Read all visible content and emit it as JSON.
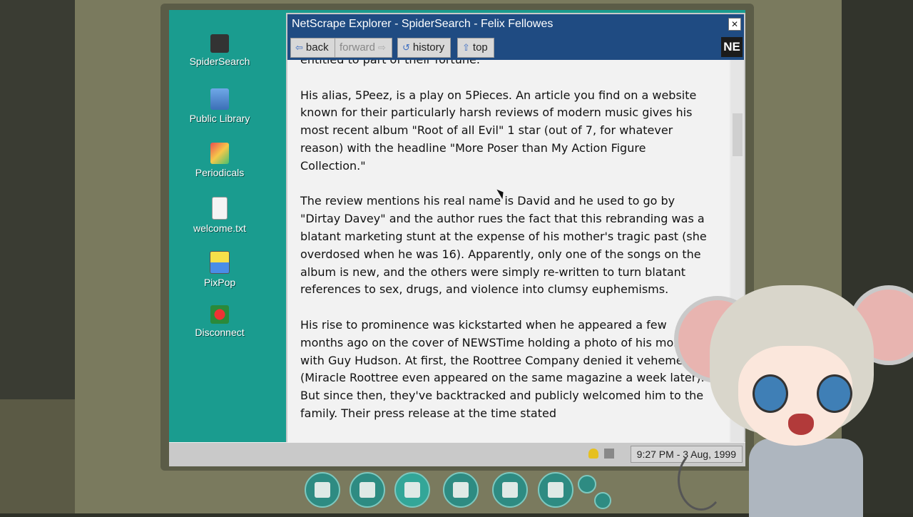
{
  "desktop": {
    "icons": [
      {
        "label": "SpiderSearch",
        "icon": "spider-icon"
      },
      {
        "label": "Public Library",
        "icon": "book-icon"
      },
      {
        "label": "Periodicals",
        "icon": "magazine-icon"
      },
      {
        "label": "welcome.txt",
        "icon": "text-file-icon"
      },
      {
        "label": "PixPop",
        "icon": "image-icon"
      },
      {
        "label": "Disconnect",
        "icon": "disconnect-icon"
      }
    ]
  },
  "window": {
    "title": "NetScrape Explorer - SpiderSearch - Felix Fellowes",
    "close_label": "✕",
    "toolbar": {
      "back_label": "back",
      "back_arrow": "⇦",
      "forward_label": "forward",
      "forward_arrow": "⇨",
      "history_label": "history",
      "history_icon": "↺",
      "top_label": "top",
      "top_arrow": "⇧",
      "logo_text": "NE"
    },
    "article": {
      "paragraphs": [
        "entitled to part of their fortune.",
        "His alias, 5Peez, is a play on 5Pieces. An article you find on a website known for their particularly harsh reviews of modern music gives his most recent album \"Root of all Evil\" 1 star (out of 7, for whatever reason) with the headline \"More Poser than My Action Figure Collection.\"",
        "The review mentions his real name is David and he used to go by \"Dirtay Davey\" and the author rues the fact that this rebranding was a blatant marketing stunt at the expense of his mother's tragic past (she overdosed when he was 16). Apparently, only one of the songs on the album is new, and the others were simply re-written to turn blatant references to sex, drugs, and violence into clumsy euphemisms.",
        "His rise to prominence was kickstarted when he appeared a few months ago on the cover of NEWSTime holding a photo of his mom with Guy Hudson. At first, the Roottree Company denied it vehemently (Miracle Roottree even appeared on the same magazine a week later). But since then, they've backtracked and publicly welcomed him to the family. Their press release at the time stated"
      ]
    }
  },
  "taskbar": {
    "clock": "9:27 PM - 3 Aug, 1999"
  },
  "dock": {
    "items": [
      "tools-icon",
      "search-icon",
      "computer-icon",
      "home-icon",
      "notes-icon",
      "mascot-icon"
    ]
  }
}
